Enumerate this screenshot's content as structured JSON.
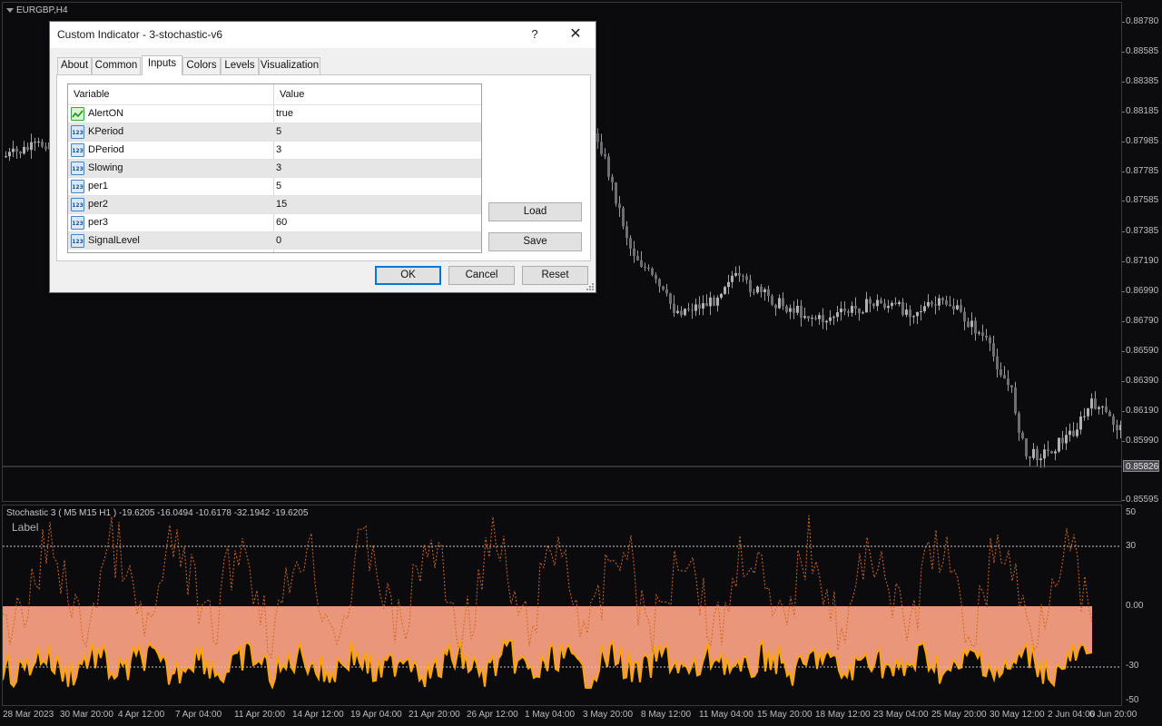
{
  "main_chart": {
    "symbol": "EURGBP,H4",
    "price_labels": [
      "0.88780",
      "0.88585",
      "0.88385",
      "0.88185",
      "0.87985",
      "0.87785",
      "0.87585",
      "0.87385",
      "0.87190",
      "0.86990",
      "0.86790",
      "0.86590",
      "0.86390",
      "0.86190",
      "0.85990",
      "0.85595"
    ],
    "current_price": "0.85826",
    "colors": {
      "candles": "#9c9c9c",
      "background": "#0b0b0e",
      "price_line": "#5a5a60"
    }
  },
  "indicator": {
    "title": "Stochastic 3 ( M5  M15  H1 ) -19.6205 -16.0494 -10.6178 -32.1942 -19.6205",
    "label": "Label",
    "levels": [
      "50",
      "30",
      "0.00",
      "-30",
      "-50"
    ],
    "colors": {
      "fill": "#e9967a",
      "line": "#ffa500",
      "dotted": "#d2691e",
      "level": "#c8c8c8"
    }
  },
  "time_axis": [
    "28 Mar 2023",
    "30 Mar 20:00",
    "4 Apr 12:00",
    "7 Apr 04:00",
    "11 Apr 20:00",
    "14 Apr 12:00",
    "19 Apr 04:00",
    "21 Apr 20:00",
    "26 Apr 12:00",
    "1 May 04:00",
    "3 May 20:00",
    "8 May 12:00",
    "11 May 04:00",
    "15 May 20:00",
    "18 May 12:00",
    "23 May 04:00",
    "25 May 20:00",
    "30 May 12:00",
    "2 Jun 04:00",
    "6 Jun 20:00"
  ],
  "dialog": {
    "title": "Custom Indicator - 3-stochastic-v6",
    "help_label": "?",
    "close_label": "✕",
    "tabs": [
      "About",
      "Common",
      "Inputs",
      "Colors",
      "Levels",
      "Visualization"
    ],
    "active_tab": "Inputs",
    "table": {
      "col_variable": "Variable",
      "col_value": "Value",
      "rows": [
        {
          "name": "AlertON",
          "value": "true",
          "icon": "bool-icon"
        },
        {
          "name": "KPeriod",
          "value": "5",
          "icon": "int-icon"
        },
        {
          "name": "DPeriod",
          "value": "3",
          "icon": "int-icon"
        },
        {
          "name": "Slowing",
          "value": "3",
          "icon": "int-icon"
        },
        {
          "name": "per1",
          "value": "5",
          "icon": "int-icon"
        },
        {
          "name": "per2",
          "value": "15",
          "icon": "int-icon"
        },
        {
          "name": "per3",
          "value": "60",
          "icon": "int-icon"
        },
        {
          "name": "SignalLevel",
          "value": "0",
          "icon": "int-icon"
        }
      ]
    },
    "buttons": {
      "load": "Load",
      "save": "Save",
      "ok": "OK",
      "cancel": "Cancel",
      "reset": "Reset"
    }
  }
}
